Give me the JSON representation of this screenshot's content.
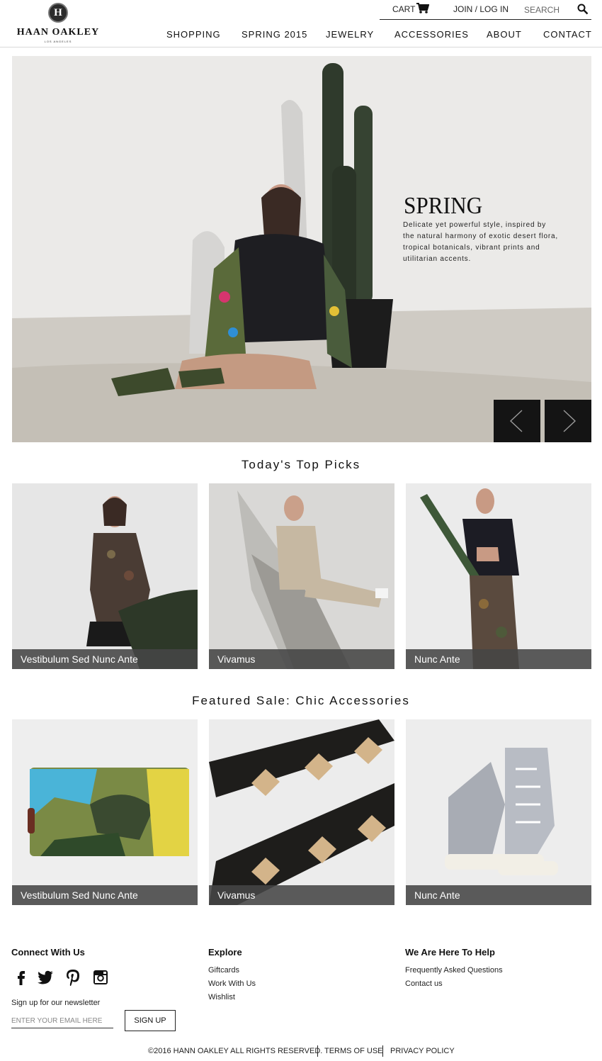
{
  "header": {
    "brand": "HAAN OAKLEY",
    "brand_sub": "LOS ANGELES",
    "badge_letter": "H",
    "cart_label": "CART",
    "join_label": "JOIN / LOG IN",
    "search_placeholder": "SEARCH",
    "nav": [
      "SHOPPING",
      "SPRING 2015",
      "JEWELRY",
      "ACCESSORIES",
      "ABOUT",
      "CONTACT"
    ]
  },
  "hero": {
    "title": "SPRING",
    "text": "Delicate yet powerful style, inspired by the natural harmony of exotic desert flora, tropical botanicals, vibrant prints and utilitarian accents."
  },
  "top_picks": {
    "title": "Today's Top Picks",
    "items": [
      "Vestibulum Sed Nunc Ante",
      "Vivamus",
      "Nunc Ante"
    ]
  },
  "featured": {
    "title": "Featured Sale: Chic Accessories",
    "items": [
      "Vestibulum Sed Nunc Ante",
      "Vivamus",
      "Nunc Ante"
    ]
  },
  "footer": {
    "connect_title": "Connect With Us",
    "newsletter_label": "Sign up for our newsletter",
    "email_placeholder": "ENTER YOUR EMAIL HERE",
    "signup_label": "SIGN UP",
    "explore_title": "Explore",
    "explore_links": [
      "Giftcards",
      "Work With Us",
      "Wishlist"
    ],
    "help_title": "We Are Here To Help",
    "help_links": [
      "Frequently Asked Questions",
      "Contact us"
    ],
    "copyright": "©2016 HANN OAKLEY  ALL RIGHTS RESERVED.",
    "terms": "TERMS OF USE",
    "privacy": "PRIVACY POLICY"
  },
  "icons": {
    "social": [
      "facebook-icon",
      "twitter-icon",
      "pinterest-icon",
      "instagram-icon"
    ]
  },
  "colors": {
    "text": "#111111",
    "label_bg": "#464646",
    "arrow_bg": "#141414"
  }
}
